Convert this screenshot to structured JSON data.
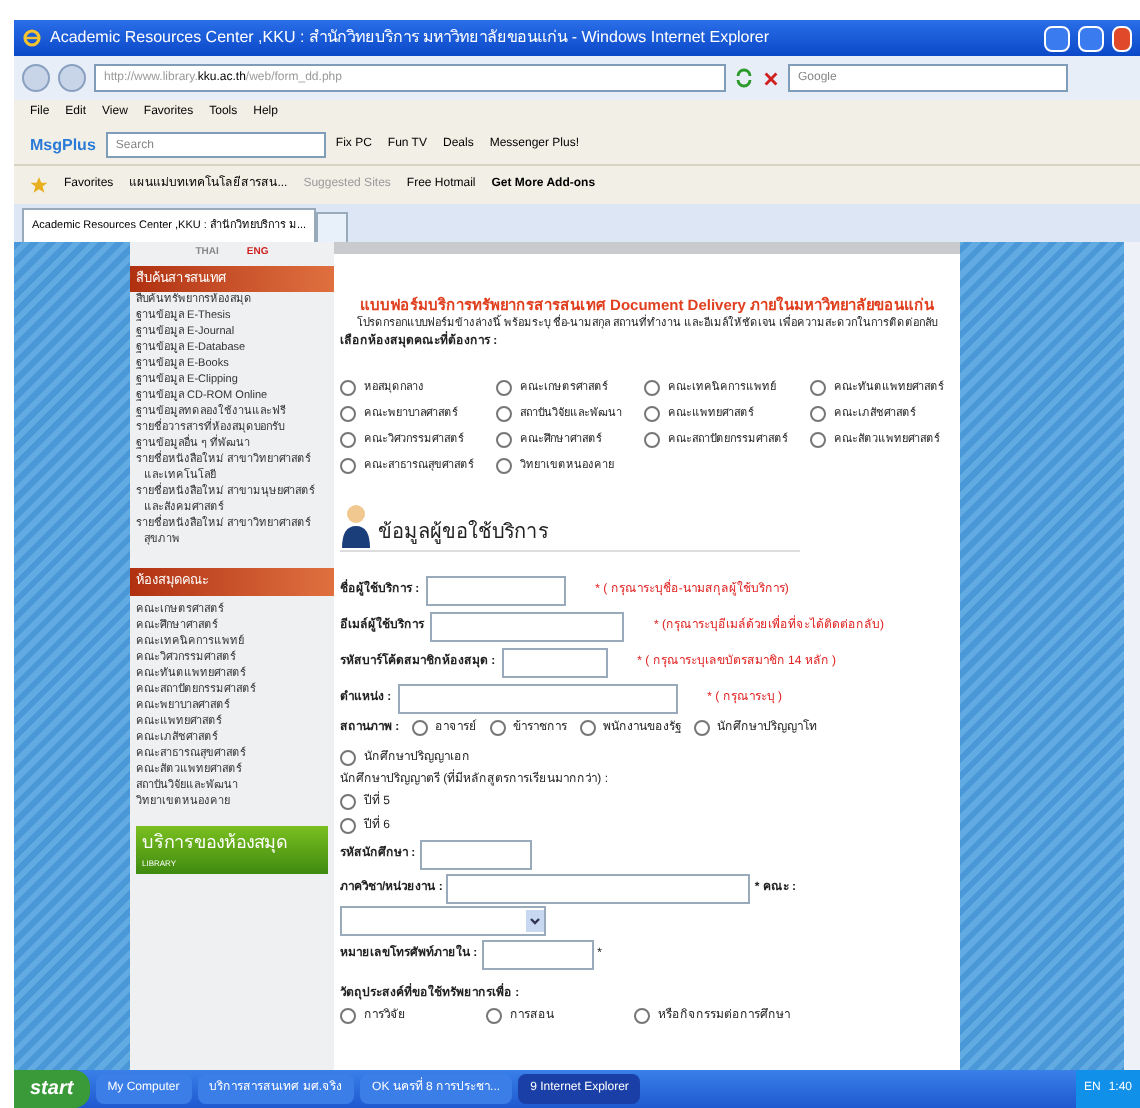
{
  "window": {
    "title": "Academic Resources Center ,KKU : สำนักวิทยบริการ มหาวิทยาลัยขอนแก่น - Windows Internet Explorer"
  },
  "address_bar": {
    "url_dim": "http://www.library.",
    "url_host": "kku.ac.th",
    "url_path": "/web/form_dd.php",
    "search_placeholder": "Google"
  },
  "menu": [
    "File",
    "Edit",
    "View",
    "Favorites",
    "Tools",
    "Help"
  ],
  "toolbar": {
    "brand": "MsgPlus",
    "search_placeholder": "Search",
    "items": [
      "Fix PC",
      "Fun TV",
      "Deals",
      "Messenger Plus!"
    ]
  },
  "favorites_bar": {
    "label": "Favorites",
    "links": [
      {
        "text": "แผนแม่บทเทคโนโลยีสารสน...",
        "kind": "link"
      },
      {
        "text": "Suggested Sites",
        "kind": "dim"
      },
      {
        "text": "Free Hotmail",
        "kind": "link"
      },
      {
        "text": "Get More Add-ons",
        "kind": "bold"
      }
    ]
  },
  "tabs": [
    {
      "label": "Academic Resources Center ,KKU : สำนักวิทยบริการ ม...",
      "selected": true
    }
  ],
  "page": {
    "languages": [
      {
        "label": "THAI",
        "selected": false
      },
      {
        "label": "ENG",
        "selected": true
      }
    ],
    "sidebar": [
      {
        "heading": "สืบค้นสารสนเทศ",
        "items": [
          "สืบค้นทรัพยากรห้องสมุด",
          "ฐานข้อมูล E-Thesis",
          "ฐานข้อมูล E-Journal",
          "ฐานข้อมูล E-Database",
          "ฐานข้อมูล E-Books",
          "ฐานข้อมูล E-Clipping",
          "ฐานข้อมูล CD-ROM Online",
          "ฐานข้อมูลทดลองใช้งานและฟรี",
          "รายชื่อวารสารที่ห้องสมุดบอกรับ",
          "ฐานข้อมูลอื่น ๆ ที่พัฒนา",
          "รายชื่อหนังสือใหม่ สาขาวิทยาศาสตร์และเทคโนโลยี",
          "รายชื่อหนังสือใหม่ สาขามนุษยศาสตร์และสังคมศาสตร์",
          "รายชื่อหนังสือใหม่ สาขาวิทยาศาสตร์สุขภาพ"
        ]
      },
      {
        "heading": "ห้องสมุดคณะ",
        "items": [
          "คณะเกษตรศาสตร์",
          "คณะศึกษาศาสตร์",
          "คณะเทคนิคการแพทย์",
          "คณะวิศวกรรมศาสตร์",
          "คณะทันตแพทยศาสตร์",
          "คณะสถาปัตยกรรมศาสตร์",
          "คณะพยาบาลศาสตร์",
          "คณะแพทยศาสตร์",
          "คณะเภสัชศาสตร์",
          "คณะสาธารณสุขศาสตร์",
          "คณะสัตวแพทยศาสตร์",
          "สถาบันวิจัยและพัฒนา",
          "วิทยาเขตหนองคาย"
        ]
      }
    ],
    "banner": {
      "title": "บริการของห้องสมุด",
      "subtitle": "LIBRARY"
    },
    "form_title": "แบบฟอร์มบริการทรัพยากรสารสนเทศ Document Delivery ภายในมหาวิทยาลัยขอนแก่น",
    "intro": "โปรดกรอกแบบฟอร์มข้างล่างนี้ พร้อมระบุ ชื่อ-นามสกุล สถานที่ทำงาน และอีเมล์ให้ชัดเจน เพื่อความสะดวกในการติดต่อกลับ",
    "library_label": "เลือกห้องสมุดคณะที่ต้องการ :",
    "libraries": [
      {
        "label": "หอสมุดกลาง",
        "checked": false
      },
      {
        "label": "คณะเกษตรศาสตร์",
        "checked": false
      },
      {
        "label": "คณะเทคนิคการแพทย์",
        "checked": false
      },
      {
        "label": "คณะทันตแพทยศาสตร์",
        "checked": false
      },
      {
        "label": "คณะพยาบาลศาสตร์",
        "checked": false
      },
      {
        "label": "สถาบันวิจัยและพัฒนา",
        "checked": false
      },
      {
        "label": "คณะแพทยศาสตร์",
        "checked": false
      },
      {
        "label": "คณะเภสัชศาสตร์",
        "checked": false
      },
      {
        "label": "คณะวิศวกรรมศาสตร์",
        "checked": false
      },
      {
        "label": "คณะศึกษาศาสตร์",
        "checked": false
      },
      {
        "label": "คณะสถาปัตยกรรมศาสตร์",
        "checked": false
      },
      {
        "label": "คณะสัตวแพทยศาสตร์",
        "checked": false
      },
      {
        "label": "คณะสาธารณสุขศาสตร์",
        "checked": false
      },
      {
        "label": "วิทยาเขตหนองคาย",
        "checked": false
      }
    ],
    "section_heading": "ข้อมูลผู้ขอใช้บริการ",
    "fields": [
      {
        "label": "ชื่อผู้ใช้บริการ :",
        "note": "* ( กรุณาระบุชื่อ-นามสกุลผู้ใช้บริการ)"
      },
      {
        "label": "อีเมล์ผู้ใช้บริการ",
        "note": "* (กรุณาระบุอีเมล์ด้วยเพื่อที่จะได้ติดต่อกลับ)"
      },
      {
        "label": "รหัสบาร์โค้ดสมาชิกห้องสมุด :",
        "note": "* ( กรุณาระบุเลขบัตรสมาชิก 14 หลัก )"
      },
      {
        "label": "ตำแหน่ง :",
        "note": "* ( กรุณาระบุ )"
      }
    ],
    "status_label": "สถานภาพ :",
    "statuses": [
      {
        "label": "อาจารย์",
        "checked": false
      },
      {
        "label": "ข้าราชการ",
        "checked": false
      },
      {
        "label": "พนักงานของรัฐ",
        "checked": false
      },
      {
        "label": "นักศึกษาปริญญาโท",
        "checked": false
      },
      {
        "label": "นักศึกษาปริญญาเอก",
        "checked": false
      }
    ],
    "undergrad_label": "นักศึกษาปริญญาตรี (ที่มีหลักสูตรการเรียนมากกว่า) :",
    "years": [
      {
        "label": "ปีที่ 5",
        "checked": false
      },
      {
        "label": "ปีที่ 6",
        "checked": false
      }
    ],
    "student_id_label": "รหัสนักศึกษา :",
    "department_label": "ภาควิชา/หน่วยงาน :",
    "faculty_label": "* คณะ :",
    "phone_label": "หมายเลขโทรศัพท์ภายใน :",
    "phone_note": "*",
    "purpose_label": "วัตถุประสงค์ที่ขอใช้ทรัพยากรเพื่อ :",
    "purposes": [
      {
        "label": "การวิจัย",
        "checked": false
      },
      {
        "label": "การสอน",
        "checked": false
      },
      {
        "label": "หรือกิจกรรมต่อการศึกษา",
        "checked": false
      }
    ]
  },
  "taskbar": {
    "start": "start",
    "tasks": [
      {
        "label": "My Computer",
        "selected": false
      },
      {
        "label": "บริการสารสนเทศ มศ.จริง",
        "selected": false
      },
      {
        "label": "OK นครที่ 8 การประชา...",
        "selected": false
      },
      {
        "label": "9 Internet Explorer",
        "selected": true
      }
    ],
    "language": "EN",
    "clock": "1:40"
  }
}
